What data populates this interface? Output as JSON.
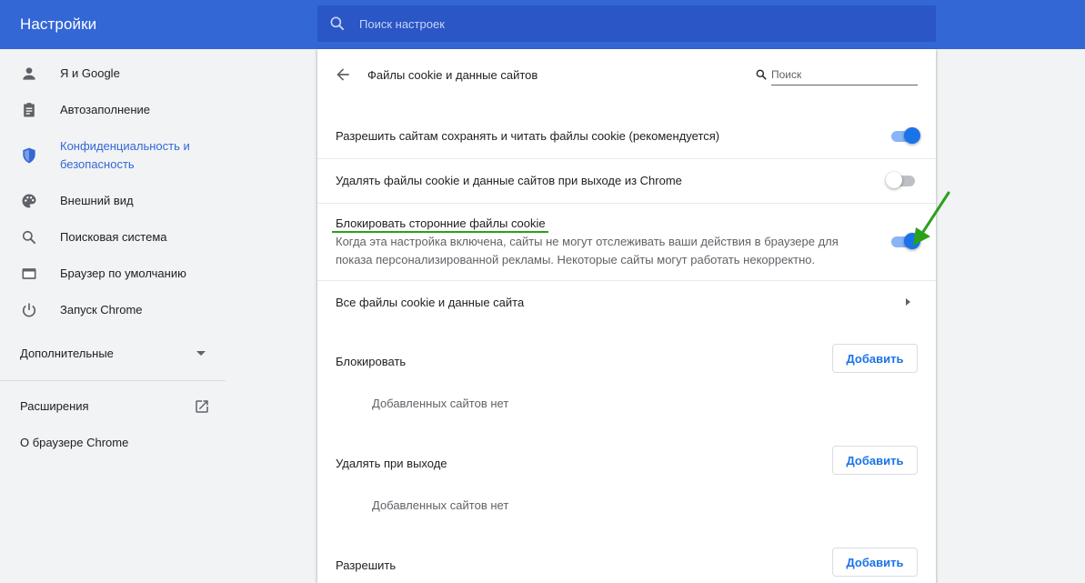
{
  "app": {
    "title": "Настройки"
  },
  "search": {
    "placeholder": "Поиск настроек"
  },
  "sidebar": {
    "items": [
      {
        "label": "Я и Google",
        "icon": "person-icon"
      },
      {
        "label": "Автозаполнение",
        "icon": "clipboard-icon"
      },
      {
        "label": "Конфиденциальность и безопасность",
        "icon": "shield-icon",
        "active": true
      },
      {
        "label": "Внешний вид",
        "icon": "palette-icon"
      },
      {
        "label": "Поисковая система",
        "icon": "search-icon"
      },
      {
        "label": "Браузер по умолчанию",
        "icon": "browser-icon"
      },
      {
        "label": "Запуск Chrome",
        "icon": "power-icon"
      }
    ],
    "advanced_label": "Дополнительные",
    "extensions_label": "Расширения",
    "about_label": "О браузере Chrome"
  },
  "page": {
    "title": "Файлы cookie и данные сайтов",
    "search_placeholder": "Поиск",
    "rows": [
      {
        "text": "Разрешить сайтам сохранять и читать файлы cookie (рекомендуется)",
        "enabled": true
      },
      {
        "text": "Удалять файлы cookie и данные сайтов при выходе из Chrome",
        "enabled": false
      },
      {
        "text": "Блокировать сторонние файлы cookie",
        "enabled": true,
        "description": "Когда эта настройка включена, сайты не могут отслеживать ваши действия в браузере для показа персонализированной рекламы. Некоторые сайты могут работать некорректно."
      },
      {
        "text": "Все файлы cookie и данные сайта"
      }
    ],
    "sections": [
      {
        "title": "Блокировать",
        "button": "Добавить",
        "empty": "Добавленных сайтов нет"
      },
      {
        "title": "Удалять при выходе",
        "button": "Добавить",
        "empty": "Добавленных сайтов нет"
      },
      {
        "title": "Разрешить",
        "button": "Добавить"
      }
    ]
  },
  "colors": {
    "header": "#3367d6",
    "accent": "#1a73e8",
    "annotation": "#2ba11a"
  }
}
